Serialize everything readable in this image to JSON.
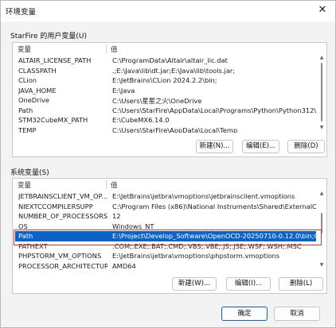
{
  "window": {
    "title": "环境变量",
    "close_glyph": "✕"
  },
  "user_vars": {
    "label": "StarFire 的用户变量(U)",
    "col_name": "变量",
    "col_value": "值",
    "rows": [
      {
        "name": "ALTAIR_LICENSE_PATH",
        "value": "C:\\ProgramData\\Altair\\altair_lic.dat"
      },
      {
        "name": "CLASSPATH",
        "value": ".;E:\\Java\\lib\\dt.jar;E:\\Java\\lib\\tools.jar;"
      },
      {
        "name": "CLion",
        "value": "E:\\JetBrains\\CLion 2024.2.2\\bin;"
      },
      {
        "name": "JAVA_HOME",
        "value": "E:\\Java"
      },
      {
        "name": "OneDrive",
        "value": "C:\\Users\\星星之火\\OneDrive"
      },
      {
        "name": "Path",
        "value": "C:\\Users\\StarFire\\AppData\\Local\\Programs\\Python\\Python312\\..."
      },
      {
        "name": "STM32CubeMX_PATH",
        "value": "E:\\CubeMX6.14.0"
      },
      {
        "name": "TEMP",
        "value": "C:\\Users\\StarFire\\AppData\\Local\\Temp"
      }
    ],
    "buttons": {
      "new": "新建(N)...",
      "edit": "编辑(E)...",
      "delete": "删除(D)"
    }
  },
  "system_vars": {
    "label": "系统变量(S)",
    "col_name": "变量",
    "col_value": "值",
    "rows": [
      {
        "name": "JETBRAINSCLIENT_VM_OP...",
        "value": "E:\\JetBrains\\jetbra\\vmoptions\\jetbrainsclient.vmoptions"
      },
      {
        "name": "NIEXTCCOMPILERSUPP",
        "value": "C:\\Program Files (x86)\\National Instruments\\Shared\\ExternalCo..."
      },
      {
        "name": "NUMBER_OF_PROCESSORS",
        "value": "12"
      },
      {
        "name": "OS",
        "value": "Windows_NT"
      },
      {
        "name": "Path",
        "value": "E:\\Project\\Develop_Software\\OpenOCD-20250710-0.12.0\\bin;C:..."
      },
      {
        "name": "PATHEXT",
        "value": ".COM;.EXE;.BAT;.CMD;.VBS;.VBE;.JS;.JSE;.WSF;.WSH;.MSC"
      },
      {
        "name": "PHPSTORM_VM_OPTIONS",
        "value": "E:\\JetBrains\\jetbra\\vmoptions\\phpstorm.vmoptions"
      },
      {
        "name": "PROCESSOR_ARCHITECTURE",
        "value": "AMD64"
      }
    ],
    "selected_index": 4,
    "buttons": {
      "new": "新建(W)...",
      "edit": "编辑(I)...",
      "delete": "删除(L)"
    }
  },
  "footer": {
    "ok": "确定",
    "cancel": "取消"
  },
  "colors": {
    "selection": "#0a64c8",
    "annotation_box": "#e0362f"
  }
}
